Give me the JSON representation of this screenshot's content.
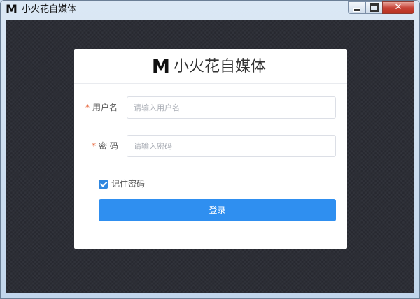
{
  "window": {
    "logo_letter": "M",
    "title": "小火花自媒体",
    "close_glyph": "✕"
  },
  "card": {
    "logo_letter": "M",
    "brand_name": "小火花自媒体"
  },
  "form": {
    "required_mark": "*",
    "username_label": "用户名",
    "username_placeholder": "请输入用户名",
    "password_label": "密 码",
    "password_placeholder": "请输入密码",
    "remember_label": "记住密码",
    "remember_checked": true,
    "login_label": "登录"
  },
  "colors": {
    "accent": "#2f8ff0",
    "background": "#2c2e36",
    "required": "#e65a2c"
  }
}
